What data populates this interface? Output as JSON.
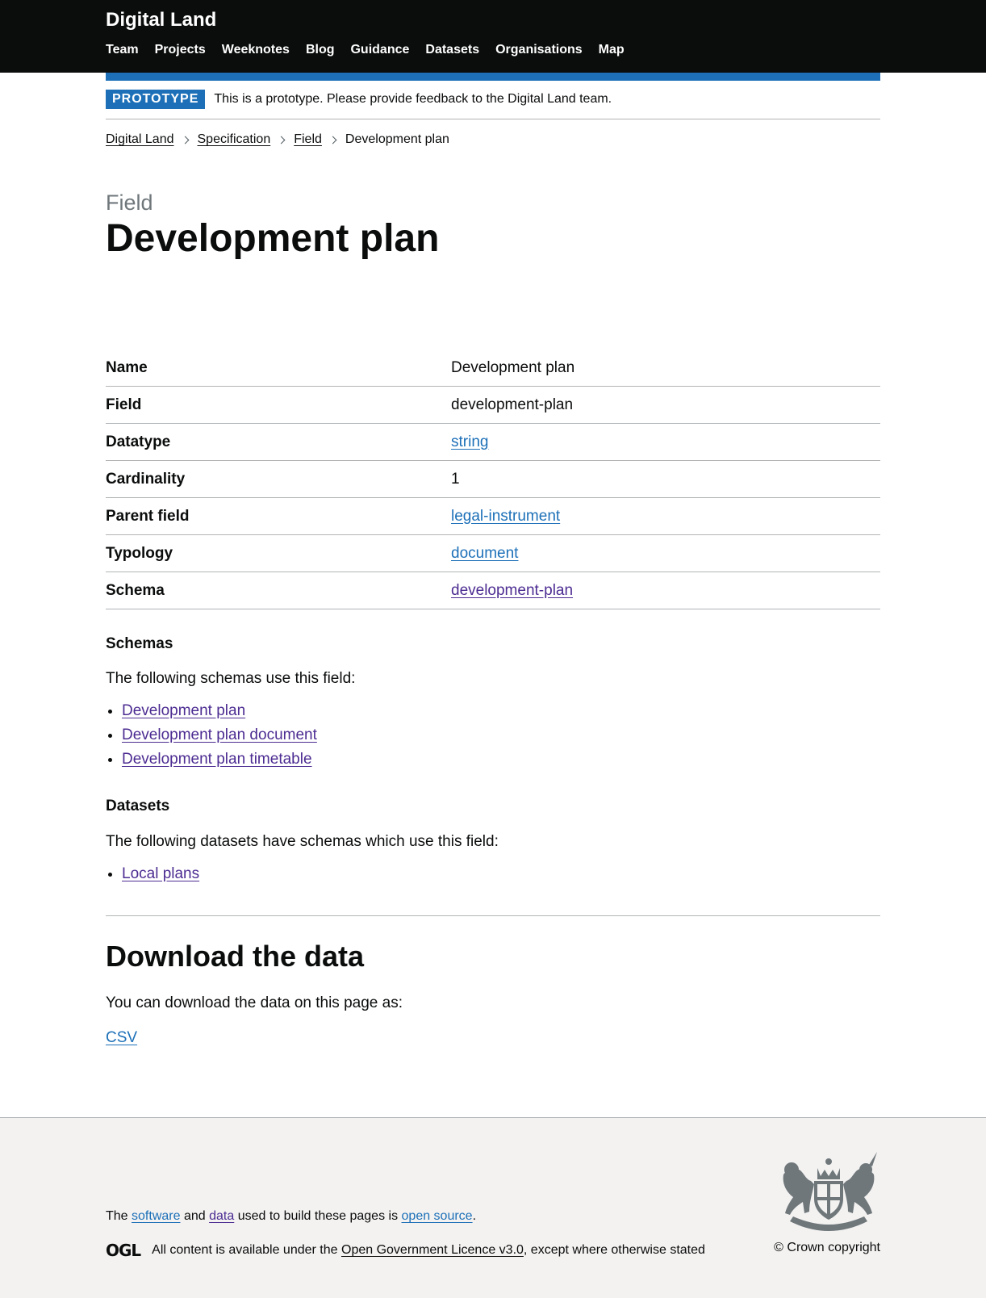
{
  "header": {
    "brand": "Digital Land",
    "nav": [
      "Team",
      "Projects",
      "Weeknotes",
      "Blog",
      "Guidance",
      "Datasets",
      "Organisations",
      "Map"
    ]
  },
  "phase": {
    "tag": "PROTOTYPE",
    "text": "This is a prototype. Please provide feedback to the Digital Land team."
  },
  "breadcrumbs": {
    "items": [
      "Digital Land",
      "Specification",
      "Field"
    ],
    "current": "Development plan"
  },
  "page": {
    "caption": "Field",
    "title": "Development plan"
  },
  "summary": {
    "rows": [
      {
        "key": "Name",
        "value": "Development plan"
      },
      {
        "key": "Field",
        "value": "development-plan"
      },
      {
        "key": "Datatype",
        "value": "string"
      },
      {
        "key": "Cardinality",
        "value": "1"
      },
      {
        "key": "Parent field",
        "value": "legal-instrument"
      },
      {
        "key": "Typology",
        "value": "document"
      },
      {
        "key": "Schema",
        "value": "development-plan"
      }
    ]
  },
  "schemas": {
    "heading": "Schemas",
    "intro": "The following schemas use this field:",
    "items": [
      "Development plan",
      "Development plan document",
      "Development plan timetable"
    ]
  },
  "datasets": {
    "heading": "Datasets",
    "intro": "The following datasets have schemas which use this field:",
    "items": [
      "Local plans"
    ]
  },
  "download": {
    "heading": "Download the data",
    "intro": "You can download the data on this page as:",
    "csv": "CSV"
  },
  "footer": {
    "text_before": "The",
    "software": "software",
    "and": "and",
    "data": "data",
    "text_middle": "used to build these pages is",
    "open_source": "open source",
    "period": ".",
    "ogl": "OGL",
    "licence_before": "All content is available under the",
    "licence_link": "Open Government Licence v3.0",
    "licence_after": ", except where otherwise stated",
    "copyright": "© Crown copyright"
  },
  "colors": {
    "header_bg": "#0b0c0c",
    "link": "#1d70b8",
    "visited_link": "#4c2c92",
    "footer_bg": "#f3f2f1"
  }
}
